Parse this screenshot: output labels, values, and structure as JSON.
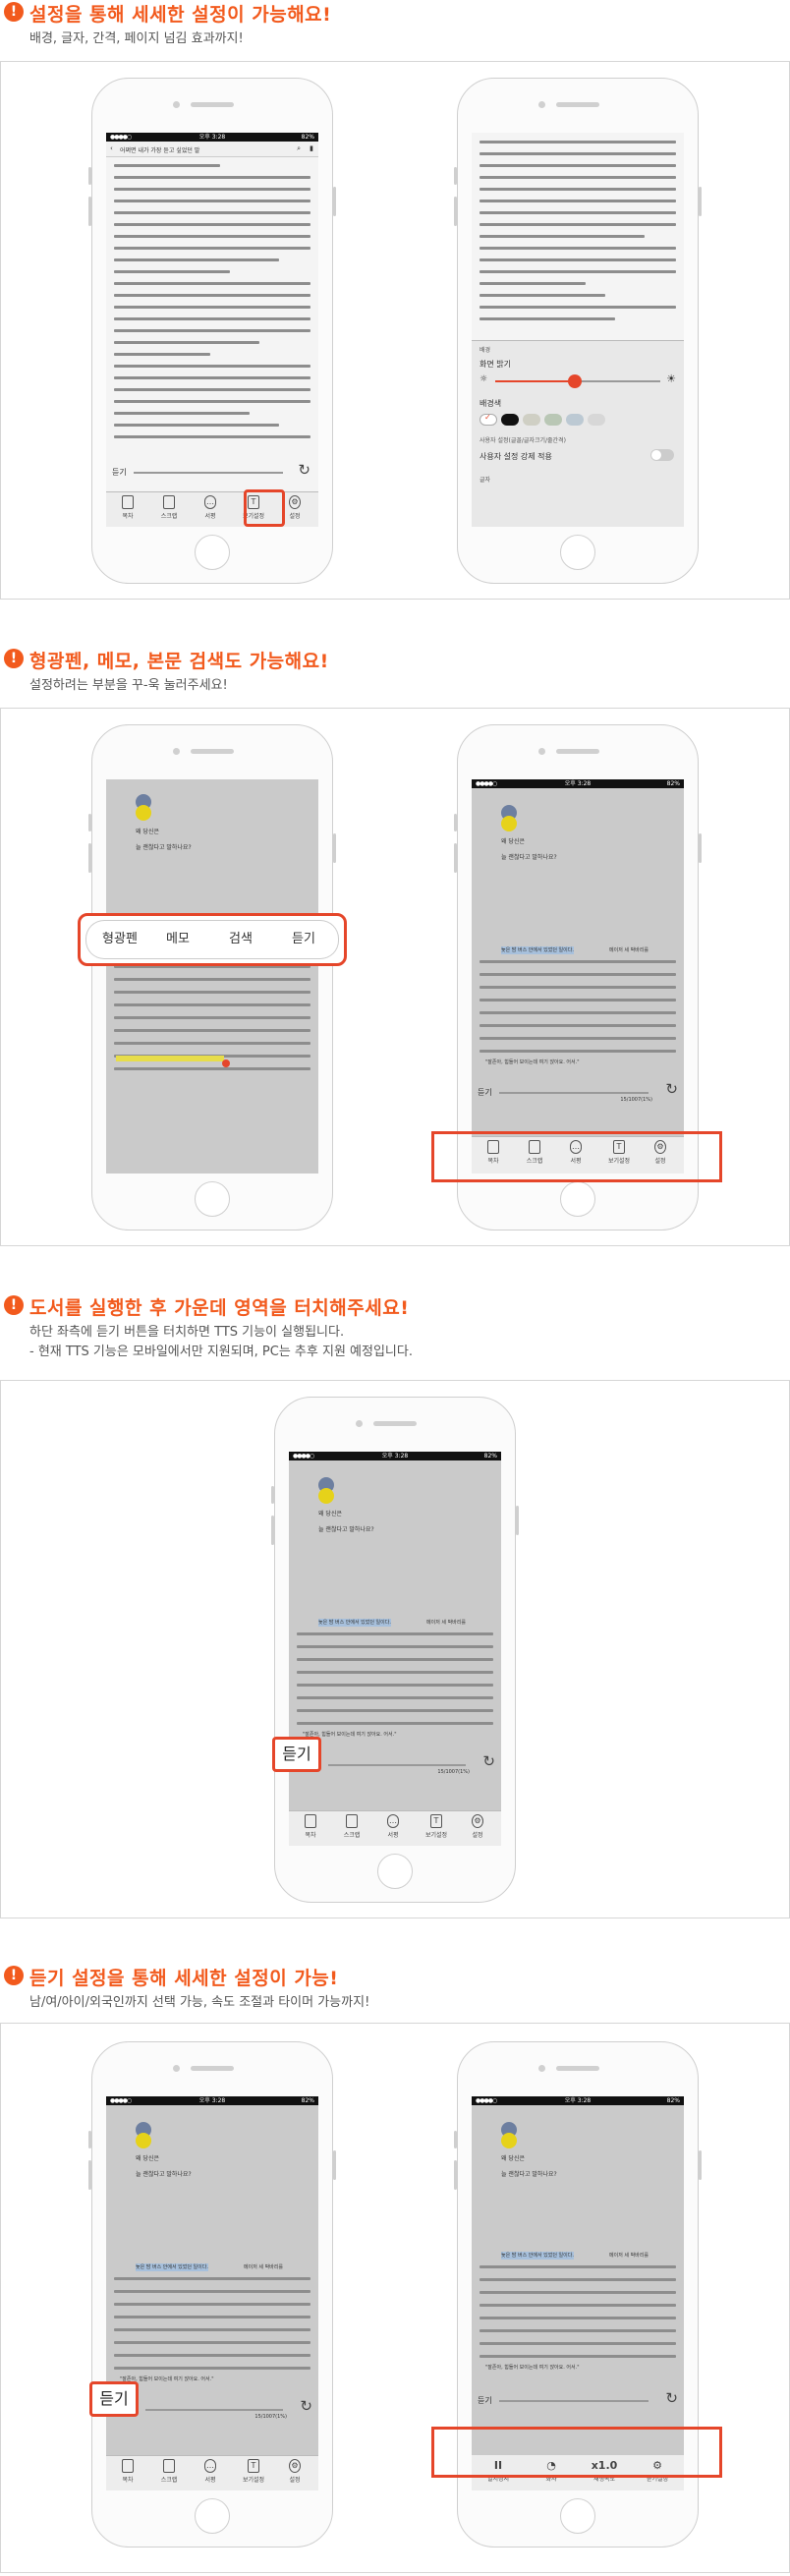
{
  "sections": [
    {
      "title": "설정을 통해 세세한 설정이 가능해요!",
      "subtitle": "배경, 글자, 간격, 페이지 넘김 효과까지!"
    },
    {
      "title": "형광펜, 메모, 본문 검색도 가능해요!",
      "subtitle": "설정하려는 부분을 꾸-욱 눌러주세요!"
    },
    {
      "title": "도서를 실행한 후 가운데 영역을 터치해주세요!",
      "subtitle": "하단 좌측에 듣기 버튼을 터치하면 TTS 기능이 실행됩니다.",
      "subtitle2": "- 현재 TTS 기능은 모바일에서만 지원되며, PC는 추후 지원 예정입니다."
    },
    {
      "title": "듣기 설정을 통해 세세한 설정이 가능!",
      "subtitle": "남/여/아이/외국인까지 선택 가능, 속도 조절과 타이머 가능까지!"
    }
  ],
  "status": {
    "carrier": "●●●●○",
    "time": "오후 3:28",
    "battery": "82%"
  },
  "reader": {
    "book_title": "어쩌면 내가 가장 듣고 싶었던 말",
    "book_heading_1": "왜 당신은",
    "book_heading_2": "늘 괜찮다고 말하나요?",
    "highlight_text": "늦은 밤 버스 안에서 있었던 일이다.",
    "body_line_1": "메이저 세 박바리를",
    "body_dialog": "\"잘존아, 힘들어 보이는데 여기 앉아요. 어서.\"",
    "listen_label": "듣기",
    "page_counter": "15/1007(1%)"
  },
  "toolbar": {
    "items": [
      {
        "label": "목차",
        "icon": "toc-icon"
      },
      {
        "label": "스크랩",
        "icon": "scrap-icon"
      },
      {
        "label": "서평",
        "icon": "review-icon"
      },
      {
        "label": "보기설정",
        "icon": "view-settings-icon"
      },
      {
        "label": "설정",
        "icon": "gear-icon"
      }
    ]
  },
  "display_settings": {
    "brightness_label": "화면 밝기",
    "background_label": "배경색",
    "custom_label": "사용자 설정 강제 적용",
    "note_label": "사용자 설정(글꼴/글자크기/줄간격)",
    "extra_label": "글자",
    "section_label": "배경"
  },
  "selection_popup": {
    "items": [
      "형광펜",
      "메모",
      "검색",
      "듣기"
    ]
  },
  "player": {
    "pause_label": "일시정지",
    "pause_icon_text": "II",
    "voice_label": "화자",
    "speed_value": "x1.0",
    "speed_label": "재생속도",
    "settings_label": "듣기설정"
  },
  "colors": {
    "accent": "#f25a1d",
    "box": "#e5462a",
    "swatches": [
      "#ffffff",
      "#111111",
      "#cfcfc4",
      "#b9c7b5",
      "#bcc9d3",
      "#d7d7d7"
    ]
  }
}
